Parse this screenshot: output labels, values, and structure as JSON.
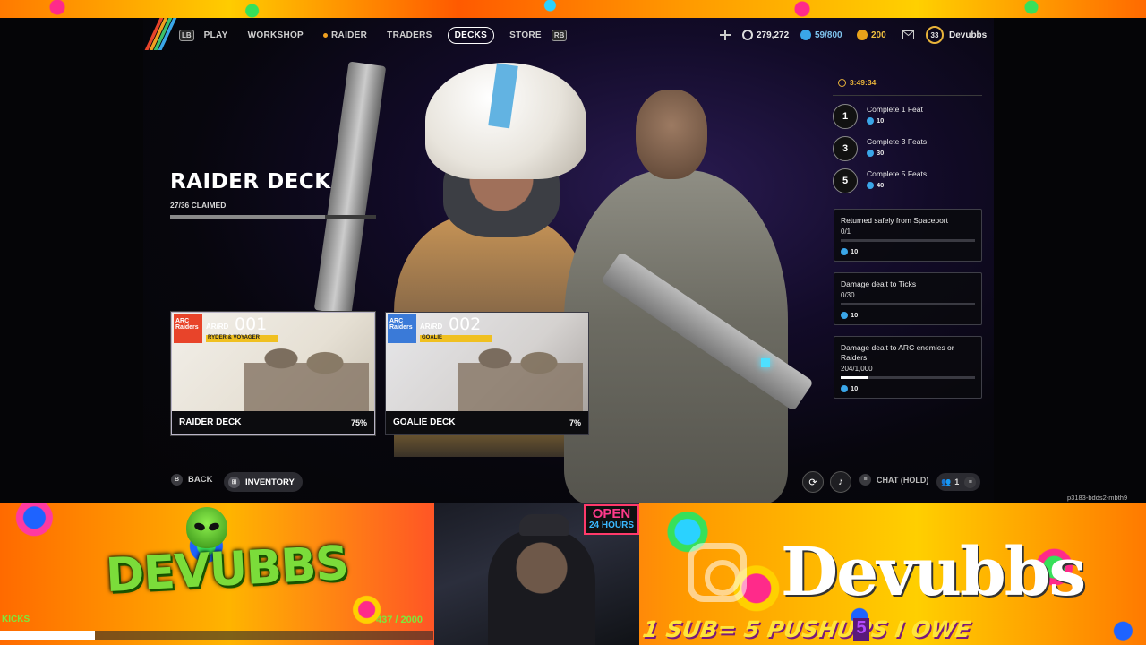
{
  "nav": {
    "lb": "LB",
    "rb": "RB",
    "items": [
      "PLAY",
      "WORKSHOP",
      "RAIDER",
      "TRADERS",
      "DECKS",
      "STORE"
    ],
    "active": "DECKS"
  },
  "currency": {
    "silver": "279,272",
    "blue": "59/800",
    "gold": "200",
    "level": "33",
    "username": "Devubbs"
  },
  "deck": {
    "title": "RAIDER DECK",
    "claimed": "27/36 CLAIMED",
    "progress_fraction": 0.75
  },
  "cards": [
    {
      "brand": "ARC Raiders",
      "code": "AR/RD",
      "number": "001",
      "subtitle": "RYDER & VOYAGER",
      "name": "RAIDER DECK",
      "percent": "75%"
    },
    {
      "brand": "ARC Raiders",
      "code": "AR/RD",
      "number": "002",
      "subtitle": "GOALIE",
      "name": "GOALIE DECK",
      "percent": "7%"
    }
  ],
  "footer": {
    "back_key": "B",
    "back_label": "BACK",
    "inventory_label": "INVENTORY",
    "chat_label": "CHAT (HOLD)",
    "party_count": "1",
    "build_id": "p3183-bdds2-mbth9"
  },
  "challenges": {
    "timer": "3:49:34",
    "tiers": [
      {
        "count": "1",
        "title": "Complete 1 Feat",
        "reward": "10"
      },
      {
        "count": "3",
        "title": "Complete 3 Feats",
        "reward": "30"
      },
      {
        "count": "5",
        "title": "Complete 5 Feats",
        "reward": "40"
      }
    ],
    "tasks": [
      {
        "title": "Returned safely from Spaceport",
        "progress": "0/1",
        "fraction": 0,
        "reward": "10"
      },
      {
        "title": "Damage dealt to Ticks",
        "progress": "0/30",
        "fraction": 0,
        "reward": "10"
      },
      {
        "title": "Damage dealt to ARC enemies or Raiders",
        "progress": "204/1,000",
        "fraction": 0.204,
        "reward": "10"
      }
    ]
  },
  "overlay": {
    "logo_text": "DEVUBBS",
    "kicks_label": "KICKS",
    "kicks_count": "437 / 2000",
    "kicks_fraction": 0.2185,
    "open_sign_top": "OPEN",
    "open_sign_bottom": "24 HOURS",
    "brand_name": "Devubbs",
    "promo": "1 SUB= 5 PUSHUPS I OWE",
    "promo_count": "5"
  },
  "colors": {
    "accent_gold": "#e8b33a",
    "currency_blue": "#3aa6e8",
    "raider_orange": "#f0a020"
  }
}
